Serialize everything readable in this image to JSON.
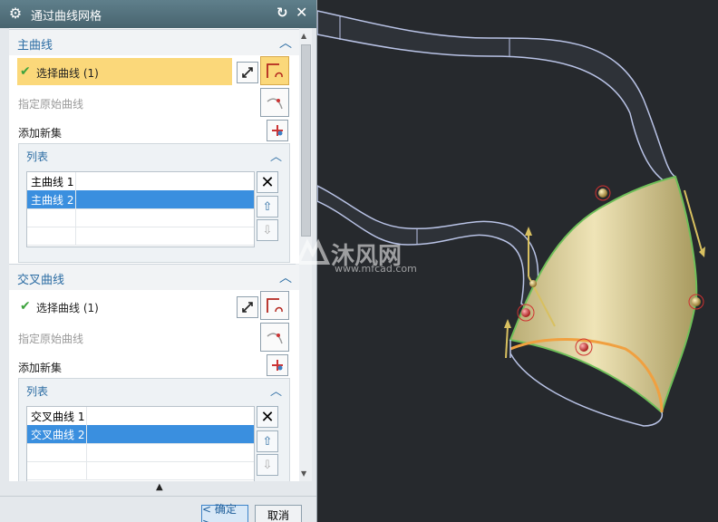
{
  "dialog": {
    "title": "通过曲线网格",
    "primary_section": {
      "heading": "主曲线",
      "select_label": "选择曲线 (1)",
      "specify_origin_label": "指定原始曲线",
      "add_new_set_label": "添加新集",
      "list": {
        "heading": "列表",
        "items": [
          "主曲线 1",
          "主曲线 2"
        ]
      }
    },
    "cross_section": {
      "heading": "交叉曲线",
      "select_label": "选择曲线 (1)",
      "specify_origin_label": "指定原始曲线",
      "add_new_set_label": "添加新集",
      "list": {
        "heading": "列表",
        "items": [
          "交叉曲线 1",
          "交叉曲线 2"
        ]
      }
    },
    "ok_label": "< 确定 >",
    "cancel_label": "取消"
  },
  "watermark": {
    "brand": "沐风网",
    "url": "www.mfcad.com"
  },
  "colors": {
    "title_bar": "#53717c",
    "accent_text": "#2b6ca3",
    "selection_highlight": "#fbd87a",
    "list_selection": "#3a8fdf",
    "viewport_bg": "#26292d",
    "surface_fill": "#d8c98f",
    "edge_green": "#6fbf59",
    "edge_orange": "#f0a040"
  }
}
